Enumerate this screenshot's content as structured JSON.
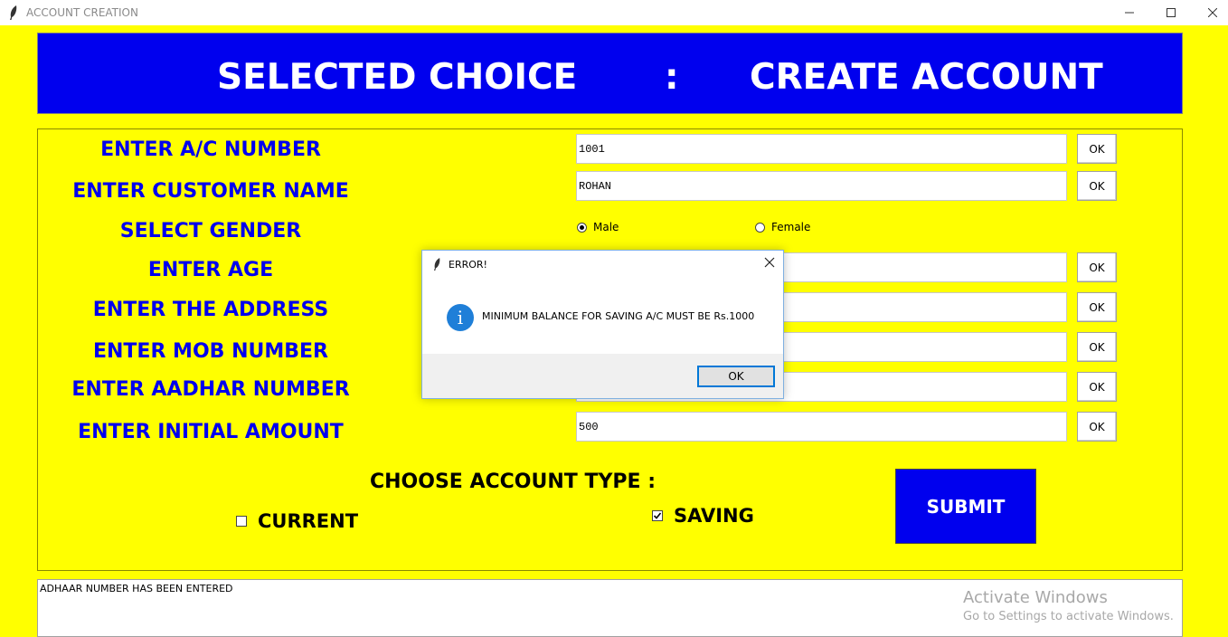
{
  "window": {
    "title": "ACCOUNT CREATION"
  },
  "header": {
    "left": "SELECTED CHOICE",
    "colon": ":",
    "right": "CREATE ACCOUNT"
  },
  "form": {
    "labels": {
      "ac_number": "ENTER A/C NUMBER",
      "customer_name": "ENTER CUSTOMER NAME",
      "gender": "SELECT GENDER",
      "age": "ENTER AGE",
      "address": "ENTER THE ADDRESS",
      "mob_number": "ENTER MOB NUMBER",
      "aadhar_number": "ENTER AADHAR NUMBER",
      "initial_amount": "ENTER INITIAL AMOUNT"
    },
    "values": {
      "ac_number": "1001",
      "customer_name": "ROHAN",
      "age": "",
      "address": "",
      "mob_number": "",
      "aadhar_number": "",
      "initial_amount": "500"
    },
    "ok_label": "OK",
    "gender_options": {
      "male": "Male",
      "female": "Female",
      "selected": "Male"
    },
    "account_type_label": "CHOOSE ACCOUNT TYPE :",
    "account_types": {
      "current": "CURRENT",
      "saving": "SAVING",
      "current_checked": false,
      "saving_checked": true
    },
    "submit_label": "SUBMIT"
  },
  "log": {
    "text": "ADHAAR NUMBER HAS BEEN ENTERED"
  },
  "watermark": {
    "line1": "Activate Windows",
    "line2": "Go to Settings to activate Windows."
  },
  "dialog": {
    "title": "ERROR!",
    "message": "MINIMUM BALANCE FOR SAVING A/C MUST BE Rs.1000",
    "icon": "info-icon",
    "ok_label": "OK"
  },
  "colors": {
    "background": "#ffff00",
    "accent_blue": "#0000ee",
    "dialog_focus": "#0078d7"
  }
}
